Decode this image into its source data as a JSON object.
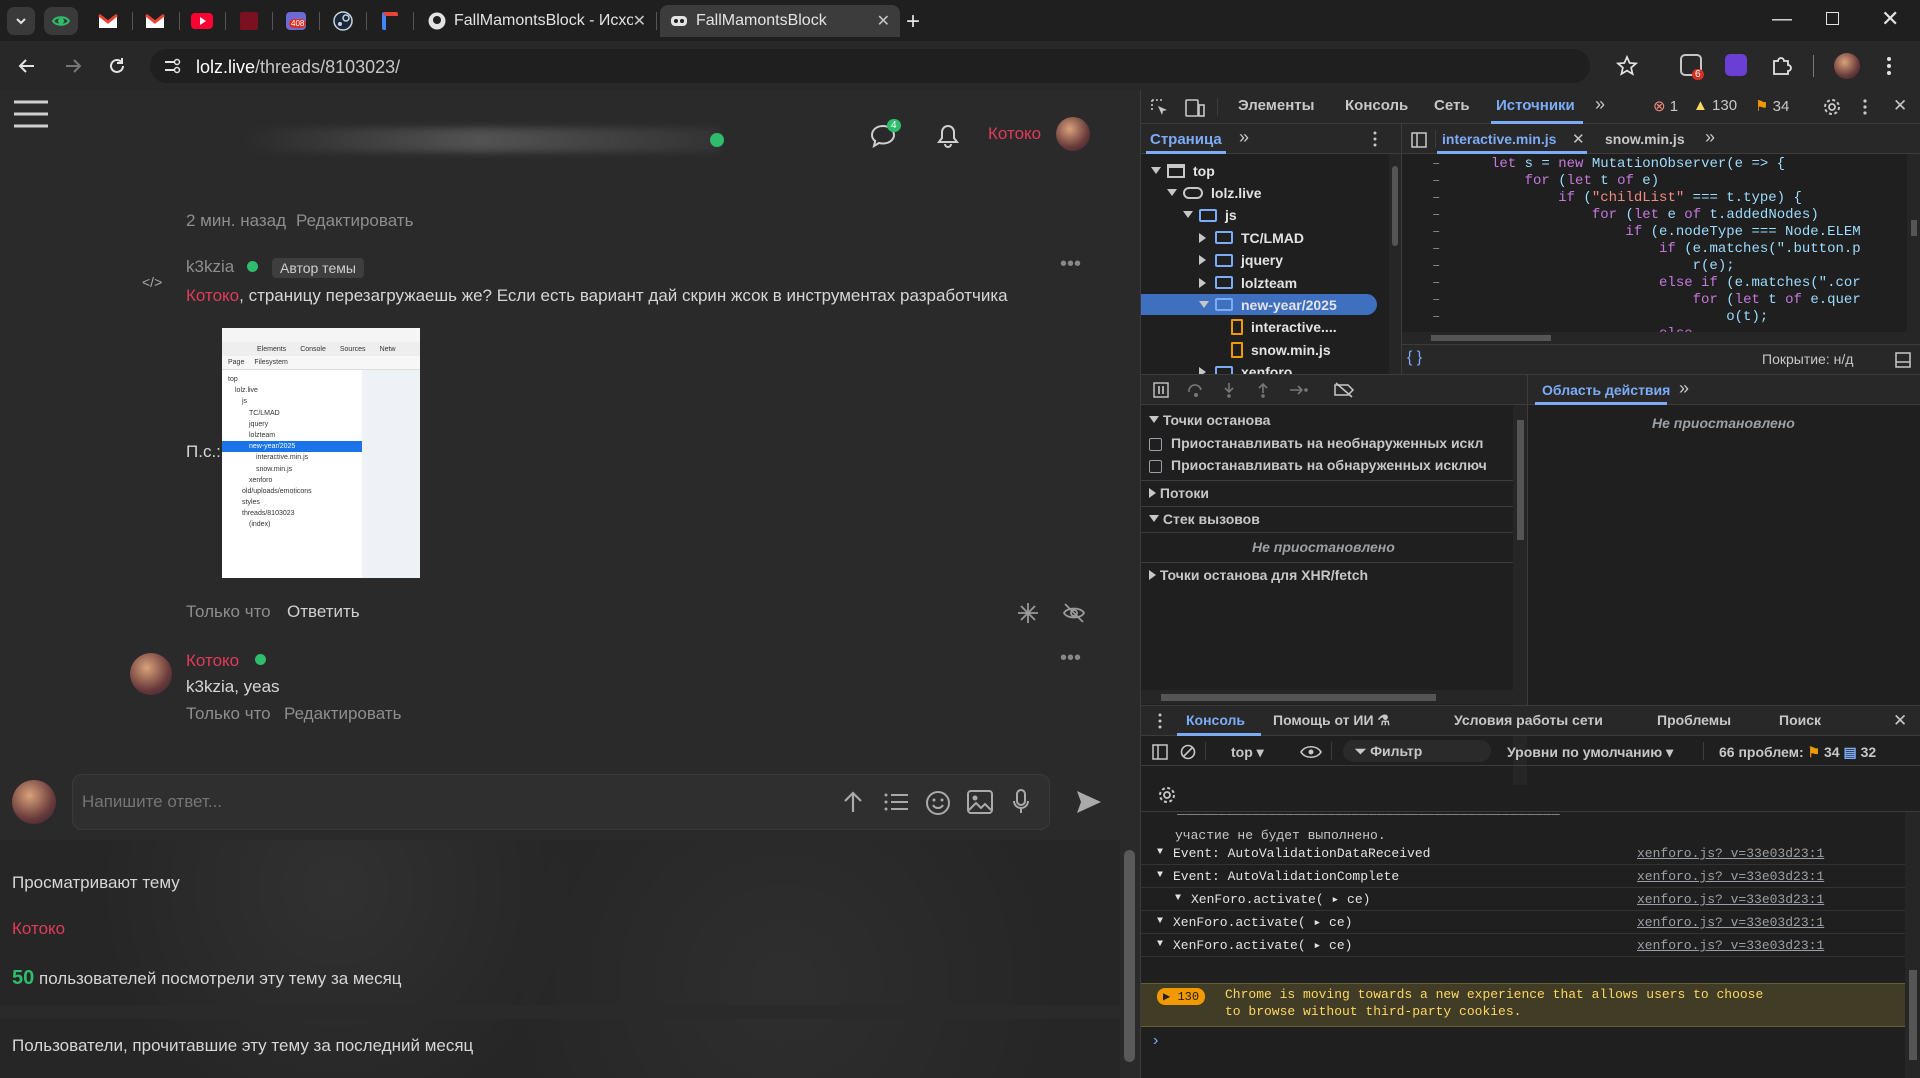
{
  "browser": {
    "tabs": [
      {
        "title": "FallMamontsBlock - Исходны",
        "active": false
      },
      {
        "title": "FallMamontsBlock",
        "active": true
      }
    ],
    "pinned_badge": "408",
    "url_host": "lolz.live",
    "url_path": "/threads/8103023/",
    "ext_badge": "6"
  },
  "forum": {
    "header": {
      "chat_badge": "4",
      "username": "Котоко"
    },
    "post1": {
      "time": "2 мин. назад",
      "edit": "Редактировать"
    },
    "post2": {
      "author": "k3kzia",
      "author_badge": "Автор темы",
      "mention": "Котоко",
      "text": ", страницу перезагружаешь же? Если есть вариант дай скрин жсок в инструментах разработчика",
      "ps_label": "П.с.:",
      "time": "Только что",
      "reply": "Ответить"
    },
    "post3": {
      "author": "Котоко",
      "mention": "k3kzia",
      "text": ", yeas",
      "time": "Только что",
      "edit": "Редактировать"
    },
    "reply_placeholder": "Напишите ответ...",
    "viewing_title": "Просматривают тему",
    "viewing_user": "Котоко",
    "views_count": "50",
    "views_text": "пользователей посмотрели эту тему за месяц",
    "readers_title": "Пользователи, прочитавшие эту тему за последний месяц"
  },
  "screenshot_thumb": {
    "tabs": [
      "Elements",
      "Console",
      "Sources",
      "Netw"
    ],
    "subtabs": [
      "Page",
      "Filesystem"
    ],
    "tree": [
      "top",
      "lolz.live",
      "js",
      "TC/LMAD",
      "jquery",
      "lolzteam",
      "new-year/2025",
      "interactive.min.js",
      "snow.min.js",
      "xenforo",
      "old/uploads/emoticons",
      "styles",
      "threads/8103023",
      "(index)"
    ]
  },
  "devtools": {
    "tabs": [
      "Элементы",
      "Консоль",
      "Сеть",
      "Источники"
    ],
    "errors": "1",
    "warnings": "130",
    "issues": "34",
    "nav_tab": "Страница",
    "file_tabs": [
      "interactive.min.js",
      "snow.min.js"
    ],
    "tree": [
      {
        "label": "top",
        "kind": "frame",
        "depth": 0,
        "open": true
      },
      {
        "label": "lolz.live",
        "kind": "cloud",
        "depth": 1,
        "open": true
      },
      {
        "label": "js",
        "kind": "folder",
        "depth": 2,
        "open": true
      },
      {
        "label": "TC/LMAD",
        "kind": "folder",
        "depth": 3,
        "open": false
      },
      {
        "label": "jquery",
        "kind": "folder",
        "depth": 3,
        "open": false
      },
      {
        "label": "lolzteam",
        "kind": "folder",
        "depth": 3,
        "open": false
      },
      {
        "label": "new-year/2025",
        "kind": "folder",
        "depth": 3,
        "open": true,
        "selected": true
      },
      {
        "label": "interactive....",
        "kind": "file",
        "depth": 4
      },
      {
        "label": "snow.min.js",
        "kind": "file",
        "depth": 4
      },
      {
        "label": "xenforo",
        "kind": "folder",
        "depth": 3,
        "open": false
      }
    ],
    "code": [
      "let s = new MutationObserver(e => {",
      "    for (let t of e)",
      "        if (\"childList\" === t.type) {",
      "            for (let e of t.addedNodes)",
      "                if (e.nodeType === Node.ELEM",
      "                    if (e.matches(\".button.p",
      "                        r(e);",
      "                    else if (e.matches(\".cor",
      "                        for (let t of e.quer",
      "                            o(t);",
      "                    else"
    ],
    "coverage": "Покрытие: н/д",
    "breakpoints_title": "Точки останова",
    "bp_uncaught": "Приостанавливать на необнаруженных искл",
    "bp_caught": "Приостанавливать на обнаруженных исключ",
    "threads": "Потоки",
    "callstack": "Стек вызовов",
    "not_paused": "Не приостановлено",
    "xhr_bp": "Точки останова для XHR/fetch",
    "scope_tab": "Область действия",
    "scope_not_paused": "Не приостановлено",
    "drawer_tabs": [
      "Консоль",
      "Помощь от ИИ",
      "Условия работы сети",
      "Проблемы",
      "Поиск"
    ],
    "console_context": "top",
    "filter": "Фильтр",
    "levels": "Уровни по умолчанию",
    "problems_label": "66 проблем:",
    "problems_warn": "34",
    "problems_info": "32",
    "console_partial": "участие не будет выполнено.",
    "console_rows": [
      {
        "text": "Event: AutoValidationDataReceived",
        "src": "xenforo.js?_v=33e03d23:1",
        "indent": 0
      },
      {
        "text": "Event: AutoValidationComplete",
        "src": "xenforo.js?_v=33e03d23:1",
        "indent": 0
      },
      {
        "text": "XenForo.activate( ▸ ce)",
        "src": "xenforo.js?_v=33e03d23:1",
        "indent": 1
      },
      {
        "text": "XenForo.activate( ▸ ce)",
        "src": "xenforo.js?_v=33e03d23:1",
        "indent": 0
      },
      {
        "text": "XenForo.activate( ▸ ce)",
        "src": "xenforo.js?_v=33e03d23:1",
        "indent": 0
      }
    ],
    "warn_count": "130",
    "warn_line1": "Chrome is moving towards a new experience that allows users to choose",
    "warn_line2": "to browse without third-party cookies."
  },
  "colors": {
    "accent": "#7cacf8",
    "mention": "#e03b59",
    "online": "#2fbd6b",
    "views": "#2fbd6b"
  }
}
